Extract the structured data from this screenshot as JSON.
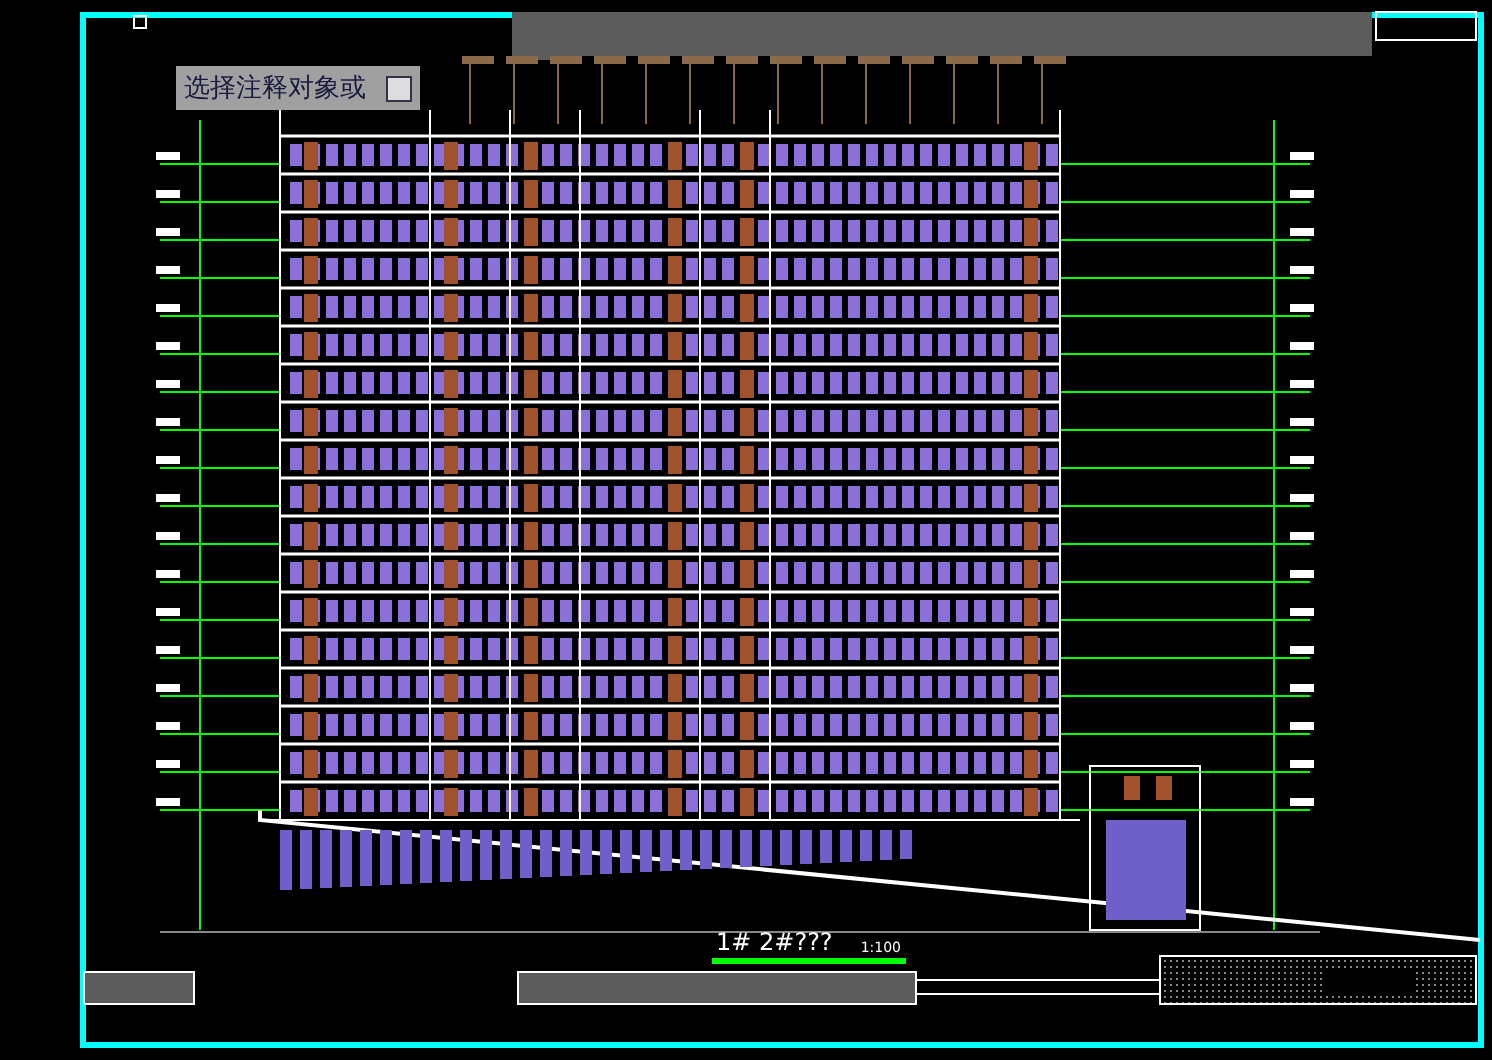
{
  "tooltip": {
    "text": "选择注释对象或"
  },
  "drawing": {
    "title": "1# 2#???",
    "scale": "1:100"
  }
}
